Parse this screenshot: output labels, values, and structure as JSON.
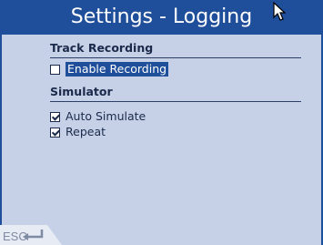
{
  "window": {
    "title": "Settings - Logging"
  },
  "sections": {
    "track_recording": {
      "header": "Track Recording"
    },
    "simulator": {
      "header": "Simulator"
    }
  },
  "options": {
    "enable_recording": {
      "label": "Enable Recording",
      "checked": false
    },
    "auto_simulate": {
      "label": "Auto Simulate",
      "checked": true
    },
    "repeat": {
      "label": "Repeat",
      "checked": true
    }
  },
  "footer": {
    "esc_label": "ESC"
  },
  "colors": {
    "title_bar": "#1f4e9a",
    "panel": "#c6d1e8",
    "text": "#1b2a4a",
    "selection": "#1f4e9a"
  },
  "icons": {
    "cursor": "arrow-cursor-icon",
    "back": "return-arrow-icon"
  }
}
